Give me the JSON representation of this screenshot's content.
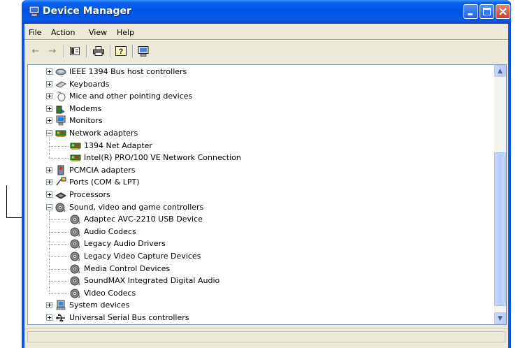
{
  "window": {
    "title": "Device Manager"
  },
  "menu": [
    "File",
    "Action",
    "View",
    "Help"
  ],
  "toolbar": [
    "back-icon",
    "forward-icon",
    "properties-icon",
    "print-icon",
    "help-icon",
    "scan-icon"
  ],
  "tree": [
    {
      "label": "IEEE 1394 Bus host controllers",
      "icon": "ieee1394-icon",
      "expanded": false,
      "level": 0
    },
    {
      "label": "Keyboards",
      "icon": "keyboard-icon",
      "expanded": false,
      "level": 0
    },
    {
      "label": "Mice and other pointing devices",
      "icon": "mouse-icon",
      "expanded": false,
      "level": 0
    },
    {
      "label": "Modems",
      "icon": "modem-icon",
      "expanded": false,
      "level": 0
    },
    {
      "label": "Monitors",
      "icon": "monitor-icon",
      "expanded": false,
      "level": 0
    },
    {
      "label": "Network adapters",
      "icon": "network-adapter-icon",
      "expanded": true,
      "level": 0
    },
    {
      "label": "1394 Net Adapter",
      "icon": "network-adapter-icon",
      "level": 1
    },
    {
      "label": "Intel(R) PRO/100 VE Network Connection",
      "icon": "network-adapter-icon",
      "level": 1
    },
    {
      "label": "PCMCIA adapters",
      "icon": "pcmcia-icon",
      "expanded": false,
      "level": 0
    },
    {
      "label": "Ports (COM & LPT)",
      "icon": "port-icon",
      "expanded": false,
      "level": 0
    },
    {
      "label": "Processors",
      "icon": "processor-icon",
      "expanded": false,
      "level": 0
    },
    {
      "label": "Sound, video and game controllers",
      "icon": "sound-icon",
      "expanded": true,
      "level": 0
    },
    {
      "label": "Adaptec AVC-2210 USB Device",
      "icon": "sound-icon",
      "level": 1
    },
    {
      "label": "Audio Codecs",
      "icon": "sound-icon",
      "level": 1
    },
    {
      "label": "Legacy Audio Drivers",
      "icon": "sound-icon",
      "level": 1
    },
    {
      "label": "Legacy Video Capture Devices",
      "icon": "sound-icon",
      "level": 1
    },
    {
      "label": "Media Control Devices",
      "icon": "sound-icon",
      "level": 1
    },
    {
      "label": "SoundMAX Integrated Digital Audio",
      "icon": "sound-icon",
      "level": 1
    },
    {
      "label": "Video Codecs",
      "icon": "sound-icon",
      "level": 1
    },
    {
      "label": "System devices",
      "icon": "system-icon",
      "expanded": false,
      "level": 0
    },
    {
      "label": "Universal Serial Bus controllers",
      "icon": "usb-icon",
      "expanded": false,
      "level": 0
    }
  ],
  "colors": {
    "titlebar": "#0054e3",
    "face": "#ece9d8",
    "scrollbar": "#c1d3fb"
  }
}
